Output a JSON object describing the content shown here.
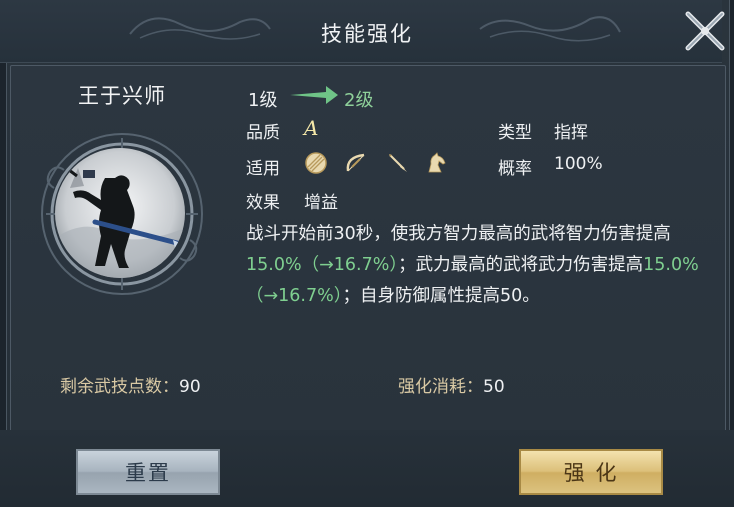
{
  "dialog": {
    "title": "技能强化"
  },
  "skill": {
    "name": "王于兴师",
    "level_from": "1级",
    "level_to": "2级",
    "quality_label": "品质",
    "quality_value": "A",
    "type_label": "类型",
    "type_value": "指挥",
    "applies_label": "适用",
    "applies_icons": [
      "shield-icon",
      "bow-icon",
      "spear-icon",
      "horse-icon"
    ],
    "chance_label": "概率",
    "chance_value": "100%",
    "effect_label": "效果",
    "effect_value": "增益",
    "desc_part1": "战斗开始前30秒，使我方智力最高的武将智力伤害提高",
    "desc_hl1": "15.0%（→16.7%）",
    "desc_part2": "；武力最高的武将武力伤害提高",
    "desc_hl2": "15.0%（→16.7%）",
    "desc_part3": "；自身防御属性提高50。"
  },
  "footer": {
    "points_label": "剩余武技点数：",
    "points_value": "90",
    "cost_label": "强化消耗：",
    "cost_value": "50"
  },
  "buttons": {
    "reset": "重置",
    "upgrade": "强 化"
  },
  "colors": {
    "highlight": "#7fcf90",
    "level_to": "#8fd19a",
    "accent_gold": "#dcc07a"
  }
}
